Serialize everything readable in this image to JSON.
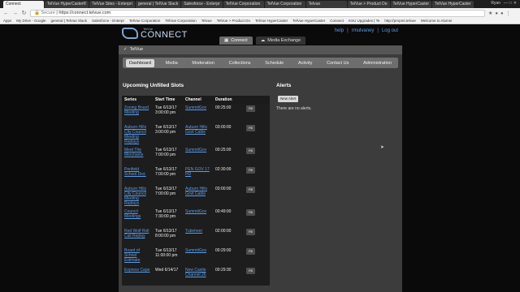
{
  "browser": {
    "tabs": [
      {
        "label": "Connect",
        "active": true
      },
      {
        "label": "TelVue HyperCaster®",
        "active": false
      },
      {
        "label": "TelVue Sites - Enterpri",
        "active": false
      },
      {
        "label": "general | TelVue Slack",
        "active": false
      },
      {
        "label": "Salesforce - Enterpr",
        "active": false
      },
      {
        "label": "TelVue Corporation",
        "active": false
      },
      {
        "label": "TelVue Corporation",
        "active": false
      },
      {
        "label": "Telvue",
        "active": false
      },
      {
        "label": "TelVue > Product Do",
        "active": false
      },
      {
        "label": "TelVue HyperCaster",
        "active": false
      },
      {
        "label": "TelVue HyperCaster",
        "active": false
      }
    ],
    "user": "Ryan",
    "address_secure": "Secure",
    "url": "https://connect.telvue.com",
    "bookmarks": [
      "Apps",
      "My Drive - Google",
      "general | TelVue Slack",
      "Salesforce - Enterpr",
      "TelVue Corporation",
      "TelVue Corporation",
      "Telvue",
      "TelVue > Product Do",
      "TelVue HyperCaster",
      "TelVue HyperCaster",
      "Connect",
      "KSU Upgrades | Te",
      "http://prnpmt.telvue",
      "Welcome to Alumni"
    ]
  },
  "header": {
    "logo_small": "TelVue",
    "logo_text": "CONNECT",
    "links": {
      "help": "help",
      "user": "rmulvaney",
      "logout": "Log out"
    },
    "app_tabs": [
      {
        "label": "Connect",
        "active": true
      },
      {
        "label": "Media Exchange",
        "active": false
      }
    ]
  },
  "panel": {
    "org_name": "TelVue",
    "nav": [
      {
        "label": "Dashboard",
        "active": true
      },
      {
        "label": "Media",
        "active": false
      },
      {
        "label": "Moderation",
        "active": false
      },
      {
        "label": "Collections",
        "active": false
      },
      {
        "label": "Schedule",
        "active": false
      },
      {
        "label": "Activity",
        "active": false
      },
      {
        "label": "Contact Us",
        "active": false
      },
      {
        "label": "Administration",
        "active": false
      }
    ]
  },
  "slots": {
    "title": "Upcoming Unfilled Slots",
    "columns": [
      "Series",
      "Start Time",
      "Channel",
      "Duration",
      ""
    ],
    "fill_label": "Fill",
    "rows": [
      {
        "series": "Zoning Board Meeting",
        "start": "Tue 6/13/17 3:00:00 pm",
        "channel": "SummitGov",
        "duration": "00:25:00"
      },
      {
        "series": "Auburn Hills City Council Meeting Replays",
        "start": "Tue 6/13/17 3:00:00 pm",
        "channel": "Auburn Hills Govt Cable",
        "duration": "03:00:00"
      },
      {
        "series": "Meet The Merchants",
        "start": "Tue 6/13/17 7:00:00 pm",
        "channel": "SummitGov",
        "duration": "00:25:00"
      },
      {
        "series": "Penfield School Dist.",
        "start": "Tue 6/13/17 7:00:00 pm",
        "channel": "PEN GOV 17 HD",
        "duration": "02:30:00"
      },
      {
        "series": "Auburn Hills City Council Meeting Replays",
        "start": "Tue 6/13/17 7:00:00 pm",
        "channel": "Auburn Hills Govt Cable",
        "duration": "03:00:00"
      },
      {
        "series": "Council Meetings",
        "start": "Tue 6/13/17 7:30:00 pm",
        "channel": "SummitGov",
        "duration": "00:49:00"
      },
      {
        "series": "Red Wolf Roll Call Replay",
        "start": "Tue 6/13/17 8:00:00 pm",
        "channel": "Tubeheer",
        "duration": "02:00:00"
      },
      {
        "series": "Board of School Estimate",
        "start": "Tue 6/13/17 11:00:00 pm",
        "channel": "SummitGov",
        "duration": "00:29:00"
      },
      {
        "series": "Express Cape",
        "start": "Wed 6/14/17",
        "channel": "New Castle Channel 26",
        "duration": "00:29:30"
      }
    ]
  },
  "alerts": {
    "title": "Alerts",
    "new_label": "New Alert",
    "empty_text": "There are no alerts."
  }
}
